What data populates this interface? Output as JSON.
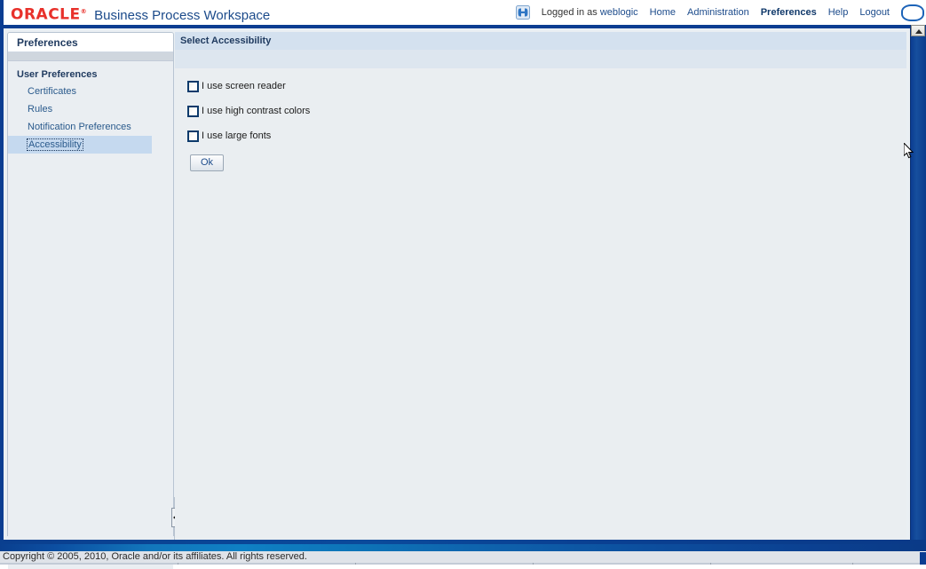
{
  "header": {
    "logo_text": "ORACLE",
    "logo_registered": "®",
    "app_title": "Business Process Workspace",
    "brand_color": "#e8312b",
    "title_color": "#1c4b8b",
    "user_icon": "linked-users-icon",
    "logged_in_prefix": "Logged in as ",
    "logged_in_user": "weblogic",
    "nav": [
      {
        "label": "Home",
        "active": false
      },
      {
        "label": "Administration",
        "active": false
      },
      {
        "label": "Preferences",
        "active": true
      },
      {
        "label": "Help",
        "active": false
      },
      {
        "label": "Logout",
        "active": false
      }
    ],
    "right_icon": "oval-badge-icon"
  },
  "sidebar": {
    "panel_title": "Preferences",
    "group_title": "User Preferences",
    "items": [
      {
        "label": "Certificates",
        "selected": false
      },
      {
        "label": "Rules",
        "selected": false
      },
      {
        "label": "Notification Preferences",
        "selected": false
      },
      {
        "label": "Accessibility",
        "selected": true
      }
    ],
    "selected_bg": "#c5d9ef",
    "link_color": "#2a5a8c"
  },
  "splitter": {
    "collapse_icon": "collapse-left-arrow-icon"
  },
  "content": {
    "header_title": "Select Accessibility",
    "header_bg": "#d4e1ef",
    "checkboxes": [
      {
        "label": "I use screen reader",
        "checked": false
      },
      {
        "label": "I use high contrast colors",
        "checked": false
      },
      {
        "label": "I use large fonts",
        "checked": false
      }
    ],
    "ok_label": "Ok"
  },
  "window": {
    "collapse_button_icon": "chevron-up-icon",
    "frame_color": "#0b3d91"
  },
  "footer": {
    "copyright": "Copyright © 2005, 2010, Oracle and/or its affiliates. All rights reserved."
  }
}
